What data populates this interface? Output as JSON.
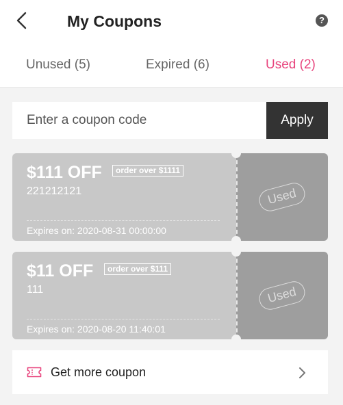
{
  "header": {
    "title": "My Coupons",
    "help_glyph": "?"
  },
  "tabs": [
    {
      "label": "Unused (5)",
      "active": false
    },
    {
      "label": "Expired (6)",
      "active": false
    },
    {
      "label": "Used (2)",
      "active": true
    }
  ],
  "code_entry": {
    "placeholder": "Enter a coupon code",
    "value": "",
    "apply_label": "Apply"
  },
  "coupons": [
    {
      "amount": "$111 OFF",
      "min_order": "order over $1111",
      "code": "221212121",
      "expires": "Expires on: 2020-08-31 00:00:00",
      "stamp": "Used"
    },
    {
      "amount": "$11 OFF",
      "min_order": "order over $111",
      "code": "111",
      "expires": "Expires on: 2020-08-20 11:40:01",
      "stamp": "Used"
    }
  ],
  "more": {
    "label": "Get more coupon"
  },
  "colors": {
    "accent": "#e8447d",
    "apply_button": "#333333",
    "coupon_body": "#c8c8c8",
    "coupon_stub": "#9e9e9e",
    "background": "#f3f3f3"
  },
  "icons": [
    "back-arrow-icon",
    "help-icon",
    "ticket-icon",
    "chevron-right-icon"
  ]
}
